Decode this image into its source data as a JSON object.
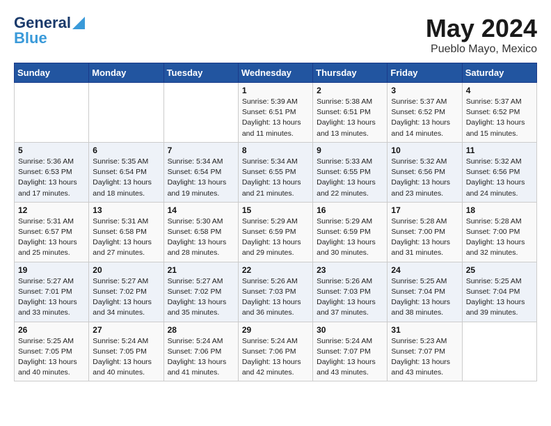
{
  "header": {
    "logo_line1": "General",
    "logo_line2": "Blue",
    "month_title": "May 2024",
    "subtitle": "Pueblo Mayo, Mexico"
  },
  "weekdays": [
    "Sunday",
    "Monday",
    "Tuesday",
    "Wednesday",
    "Thursday",
    "Friday",
    "Saturday"
  ],
  "weeks": [
    [
      {
        "day": "",
        "info": ""
      },
      {
        "day": "",
        "info": ""
      },
      {
        "day": "",
        "info": ""
      },
      {
        "day": "1",
        "info": "Sunrise: 5:39 AM\nSunset: 6:51 PM\nDaylight: 13 hours\nand 11 minutes."
      },
      {
        "day": "2",
        "info": "Sunrise: 5:38 AM\nSunset: 6:51 PM\nDaylight: 13 hours\nand 13 minutes."
      },
      {
        "day": "3",
        "info": "Sunrise: 5:37 AM\nSunset: 6:52 PM\nDaylight: 13 hours\nand 14 minutes."
      },
      {
        "day": "4",
        "info": "Sunrise: 5:37 AM\nSunset: 6:52 PM\nDaylight: 13 hours\nand 15 minutes."
      }
    ],
    [
      {
        "day": "5",
        "info": "Sunrise: 5:36 AM\nSunset: 6:53 PM\nDaylight: 13 hours\nand 17 minutes."
      },
      {
        "day": "6",
        "info": "Sunrise: 5:35 AM\nSunset: 6:54 PM\nDaylight: 13 hours\nand 18 minutes."
      },
      {
        "day": "7",
        "info": "Sunrise: 5:34 AM\nSunset: 6:54 PM\nDaylight: 13 hours\nand 19 minutes."
      },
      {
        "day": "8",
        "info": "Sunrise: 5:34 AM\nSunset: 6:55 PM\nDaylight: 13 hours\nand 21 minutes."
      },
      {
        "day": "9",
        "info": "Sunrise: 5:33 AM\nSunset: 6:55 PM\nDaylight: 13 hours\nand 22 minutes."
      },
      {
        "day": "10",
        "info": "Sunrise: 5:32 AM\nSunset: 6:56 PM\nDaylight: 13 hours\nand 23 minutes."
      },
      {
        "day": "11",
        "info": "Sunrise: 5:32 AM\nSunset: 6:56 PM\nDaylight: 13 hours\nand 24 minutes."
      }
    ],
    [
      {
        "day": "12",
        "info": "Sunrise: 5:31 AM\nSunset: 6:57 PM\nDaylight: 13 hours\nand 25 minutes."
      },
      {
        "day": "13",
        "info": "Sunrise: 5:31 AM\nSunset: 6:58 PM\nDaylight: 13 hours\nand 27 minutes."
      },
      {
        "day": "14",
        "info": "Sunrise: 5:30 AM\nSunset: 6:58 PM\nDaylight: 13 hours\nand 28 minutes."
      },
      {
        "day": "15",
        "info": "Sunrise: 5:29 AM\nSunset: 6:59 PM\nDaylight: 13 hours\nand 29 minutes."
      },
      {
        "day": "16",
        "info": "Sunrise: 5:29 AM\nSunset: 6:59 PM\nDaylight: 13 hours\nand 30 minutes."
      },
      {
        "day": "17",
        "info": "Sunrise: 5:28 AM\nSunset: 7:00 PM\nDaylight: 13 hours\nand 31 minutes."
      },
      {
        "day": "18",
        "info": "Sunrise: 5:28 AM\nSunset: 7:00 PM\nDaylight: 13 hours\nand 32 minutes."
      }
    ],
    [
      {
        "day": "19",
        "info": "Sunrise: 5:27 AM\nSunset: 7:01 PM\nDaylight: 13 hours\nand 33 minutes."
      },
      {
        "day": "20",
        "info": "Sunrise: 5:27 AM\nSunset: 7:02 PM\nDaylight: 13 hours\nand 34 minutes."
      },
      {
        "day": "21",
        "info": "Sunrise: 5:27 AM\nSunset: 7:02 PM\nDaylight: 13 hours\nand 35 minutes."
      },
      {
        "day": "22",
        "info": "Sunrise: 5:26 AM\nSunset: 7:03 PM\nDaylight: 13 hours\nand 36 minutes."
      },
      {
        "day": "23",
        "info": "Sunrise: 5:26 AM\nSunset: 7:03 PM\nDaylight: 13 hours\nand 37 minutes."
      },
      {
        "day": "24",
        "info": "Sunrise: 5:25 AM\nSunset: 7:04 PM\nDaylight: 13 hours\nand 38 minutes."
      },
      {
        "day": "25",
        "info": "Sunrise: 5:25 AM\nSunset: 7:04 PM\nDaylight: 13 hours\nand 39 minutes."
      }
    ],
    [
      {
        "day": "26",
        "info": "Sunrise: 5:25 AM\nSunset: 7:05 PM\nDaylight: 13 hours\nand 40 minutes."
      },
      {
        "day": "27",
        "info": "Sunrise: 5:24 AM\nSunset: 7:05 PM\nDaylight: 13 hours\nand 40 minutes."
      },
      {
        "day": "28",
        "info": "Sunrise: 5:24 AM\nSunset: 7:06 PM\nDaylight: 13 hours\nand 41 minutes."
      },
      {
        "day": "29",
        "info": "Sunrise: 5:24 AM\nSunset: 7:06 PM\nDaylight: 13 hours\nand 42 minutes."
      },
      {
        "day": "30",
        "info": "Sunrise: 5:24 AM\nSunset: 7:07 PM\nDaylight: 13 hours\nand 43 minutes."
      },
      {
        "day": "31",
        "info": "Sunrise: 5:23 AM\nSunset: 7:07 PM\nDaylight: 13 hours\nand 43 minutes."
      },
      {
        "day": "",
        "info": ""
      }
    ]
  ]
}
